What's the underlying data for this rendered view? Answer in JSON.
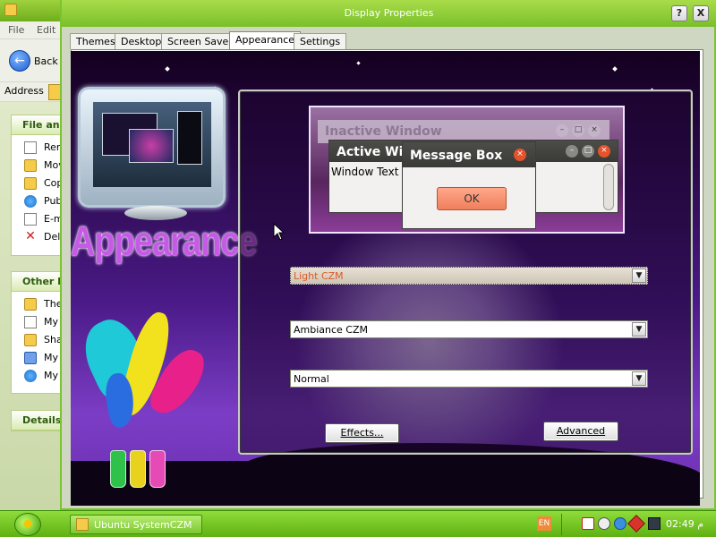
{
  "explorer": {
    "menu": [
      "File",
      "Edit"
    ],
    "back_label": "Back",
    "address_label": "Address",
    "file_panel": {
      "title": "File and Folder Tasks",
      "items": [
        "Rename this folder",
        "Move this folder",
        "Copy this folder",
        "Publish this folder to the Web",
        "E-mail this folder's files",
        "Delete this folder"
      ]
    },
    "other_panel": {
      "title": "Other Places",
      "items": [
        "Themes",
        "My Documents",
        "Shared Documents",
        "My Computer",
        "My Network Places"
      ]
    },
    "details_panel": {
      "title": "Details"
    }
  },
  "dialog": {
    "title": "Display Properties",
    "help_button": "?",
    "close_button": "X",
    "tabs": [
      {
        "label": "Themes",
        "active": false
      },
      {
        "label": "Desktop",
        "active": false
      },
      {
        "label": "Screen Saver",
        "active": false
      },
      {
        "label": "Appearance",
        "active": true
      },
      {
        "label": "Settings",
        "active": false
      }
    ],
    "banner_text": "Appearance",
    "preview": {
      "inactive_window": "Inactive Window",
      "active_window": "Active Win",
      "window_text": "Window Text",
      "message_box": "Message Box",
      "ok_button": "OK"
    },
    "windows_and_buttons": "Light CZM",
    "color_scheme": "Ambiance CZM",
    "font_size": "Normal",
    "effects_button": "Effects...",
    "advanced_button": "Advanced"
  },
  "taskbar": {
    "task_label": "Ubuntu SystemCZM",
    "language": "EN",
    "clock": "02:49 م"
  },
  "colors": {
    "titlebar_green": "#79c02a",
    "selected_text": "#dc5a28",
    "ok_button": "#ef7f5c"
  }
}
